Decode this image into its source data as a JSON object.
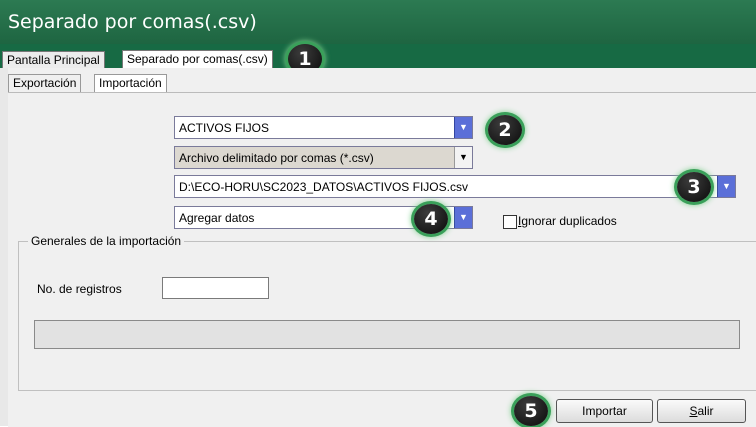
{
  "window": {
    "title": "Separado por comas(.csv)"
  },
  "main_tabs": [
    {
      "label": "Pantalla Principal"
    },
    {
      "label": "Separado por comas(.csv)"
    }
  ],
  "sub_tabs": [
    {
      "label": "Exportación"
    },
    {
      "label": "Importación"
    }
  ],
  "form": {
    "category_value": "ACTIVOS FIJOS",
    "filetype_value": "Archivo delimitado por comas (*.csv)",
    "path_value": "D:\\ECO-HORU\\SC2023_DATOS\\ACTIVOS FIJOS.csv",
    "mode_value": "Agregar datos",
    "ignore_duplicates": {
      "label_prefix": "I",
      "label_rest": "gnorar duplicados",
      "checked": false
    }
  },
  "group": {
    "title": "Generales de la importación",
    "records_label": "No. de registros",
    "records_value": ""
  },
  "buttons": {
    "import_label": "Importar",
    "exit_label_prefix": "S",
    "exit_label_rest": "alir"
  },
  "badges": [
    "1",
    "2",
    "3",
    "4",
    "5"
  ],
  "colors": {
    "title_green": "#1e6541",
    "combo_arrow": "#5b6fd8",
    "badge": "#0a0a0a"
  }
}
